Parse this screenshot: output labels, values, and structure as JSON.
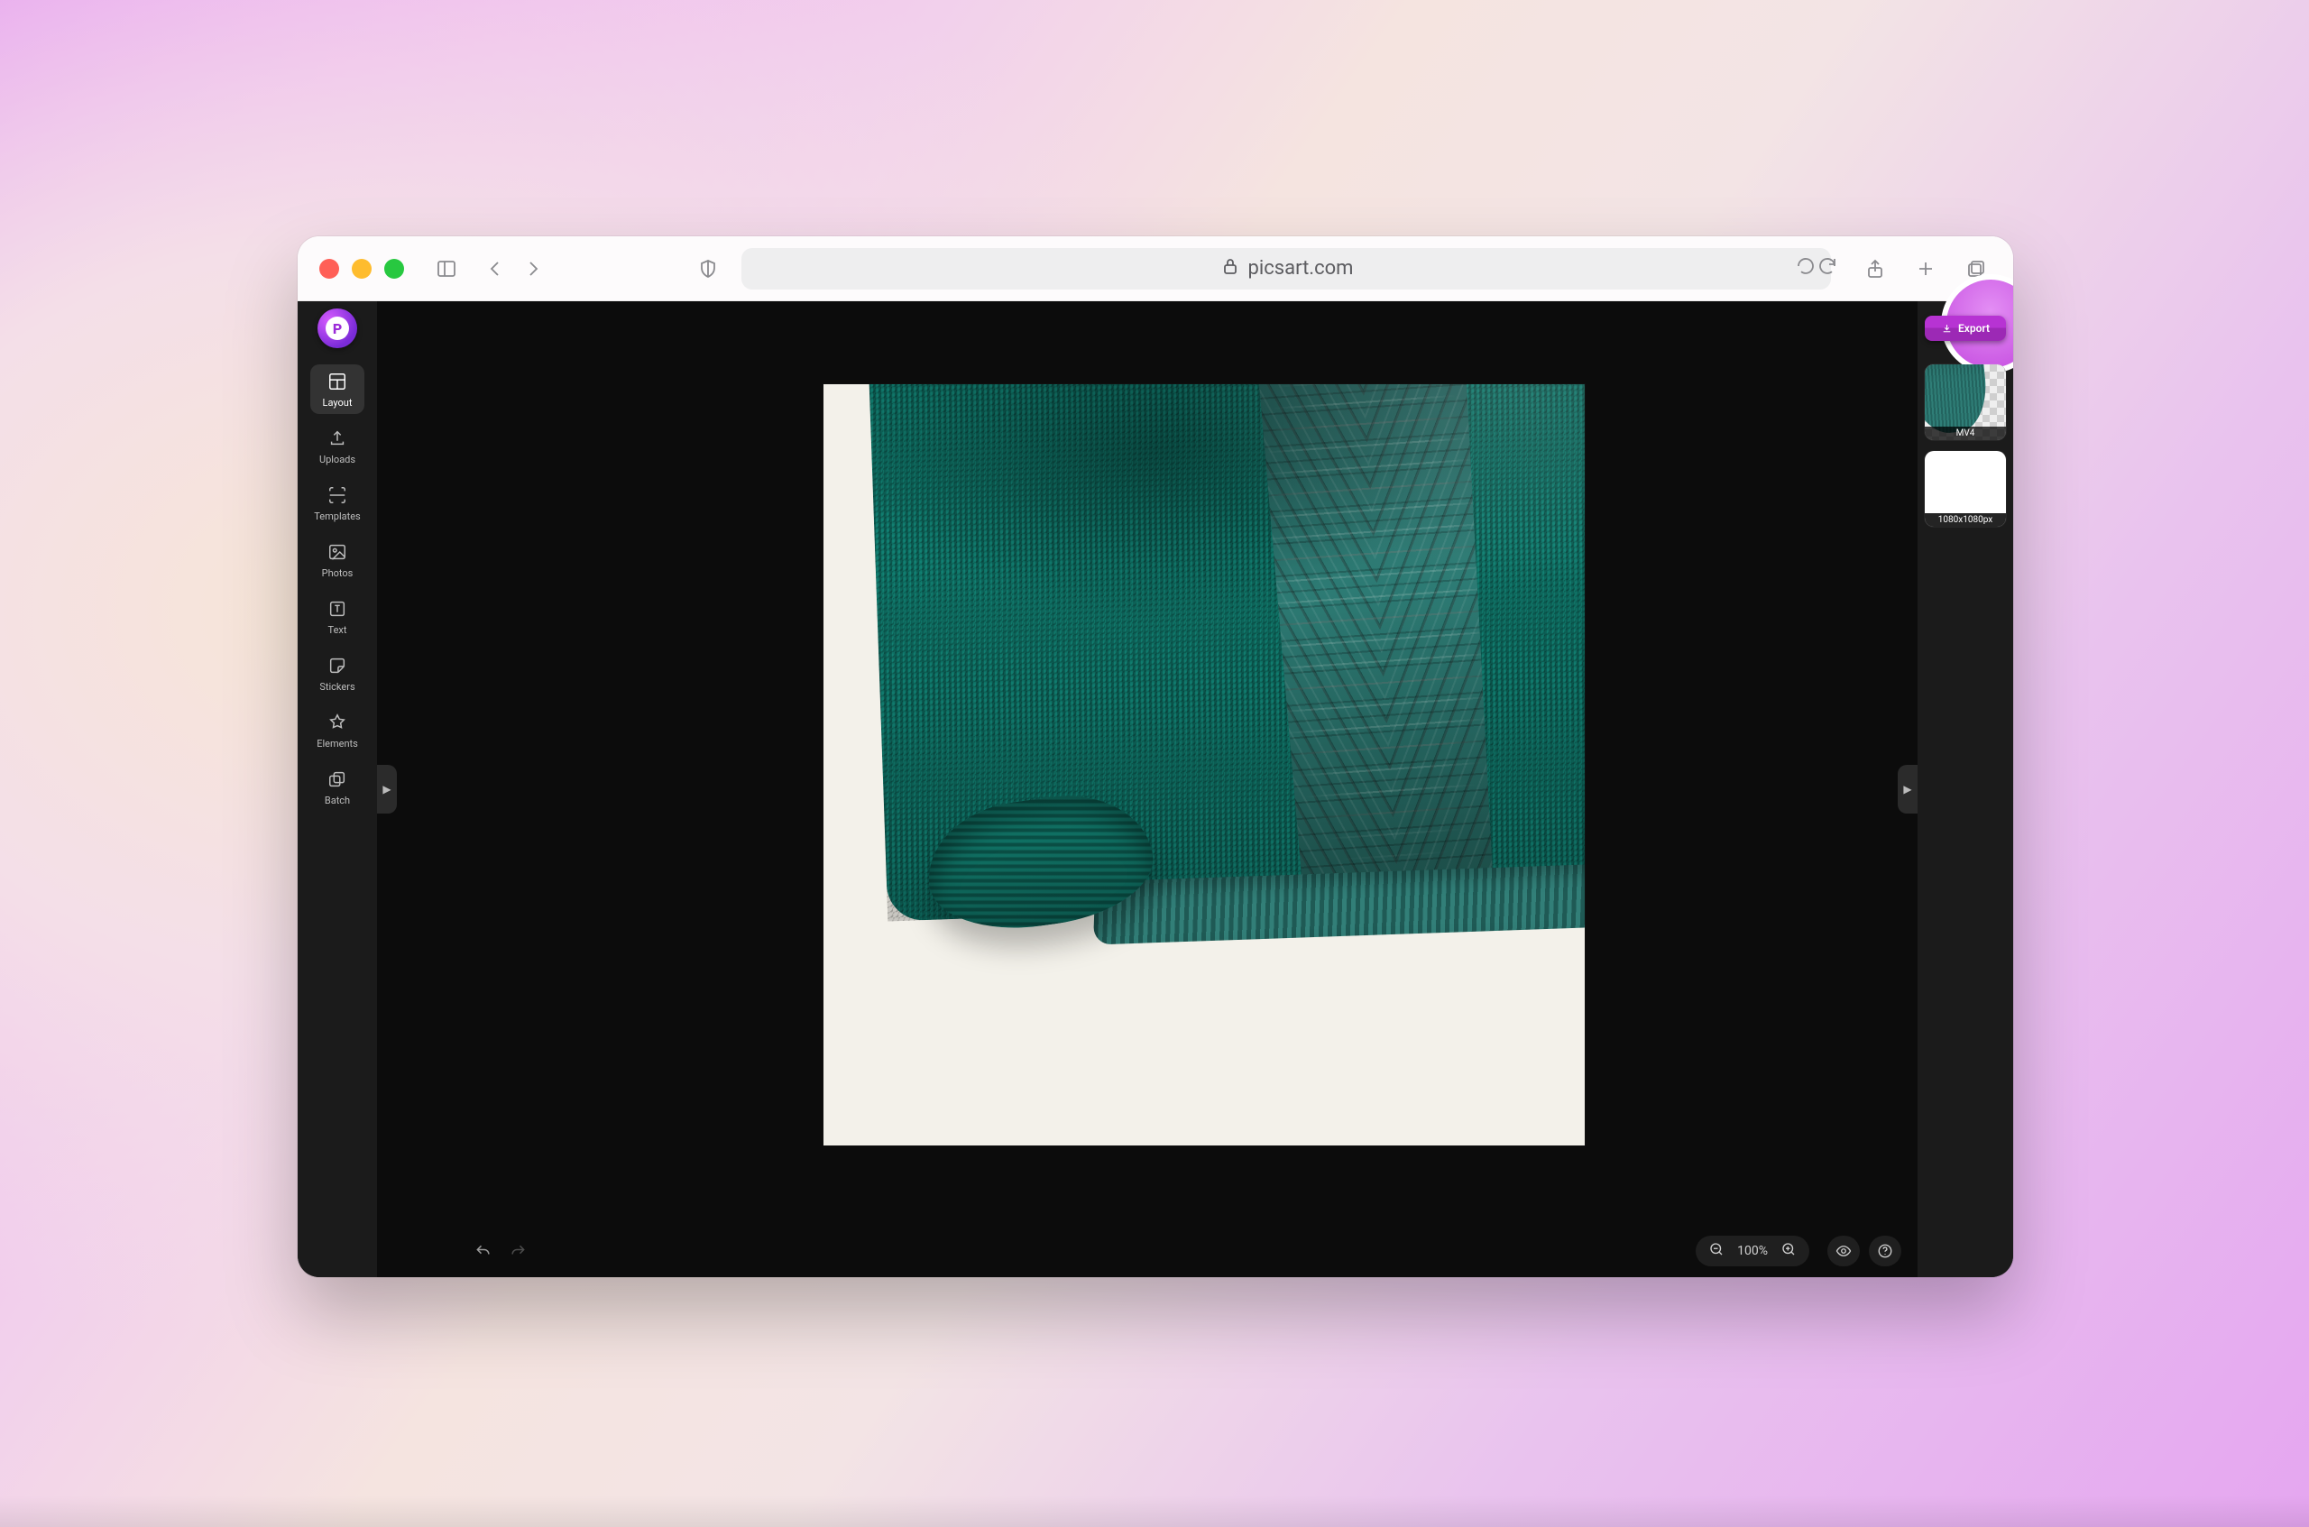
{
  "browser": {
    "url_host": "picsart.com"
  },
  "app": {
    "export_label": "Export",
    "zoom_text": "100%",
    "sidebar": {
      "items": [
        {
          "id": "layout",
          "label": "Layout"
        },
        {
          "id": "uploads",
          "label": "Uploads"
        },
        {
          "id": "templates",
          "label": "Templates"
        },
        {
          "id": "photos",
          "label": "Photos"
        },
        {
          "id": "text",
          "label": "Text"
        },
        {
          "id": "stickers",
          "label": "Stickers"
        },
        {
          "id": "elements",
          "label": "Elements"
        },
        {
          "id": "batch",
          "label": "Batch"
        }
      ]
    },
    "layers": [
      {
        "id": "img",
        "caption": "MV4"
      },
      {
        "id": "blank",
        "caption": "1080x1080px"
      }
    ]
  }
}
